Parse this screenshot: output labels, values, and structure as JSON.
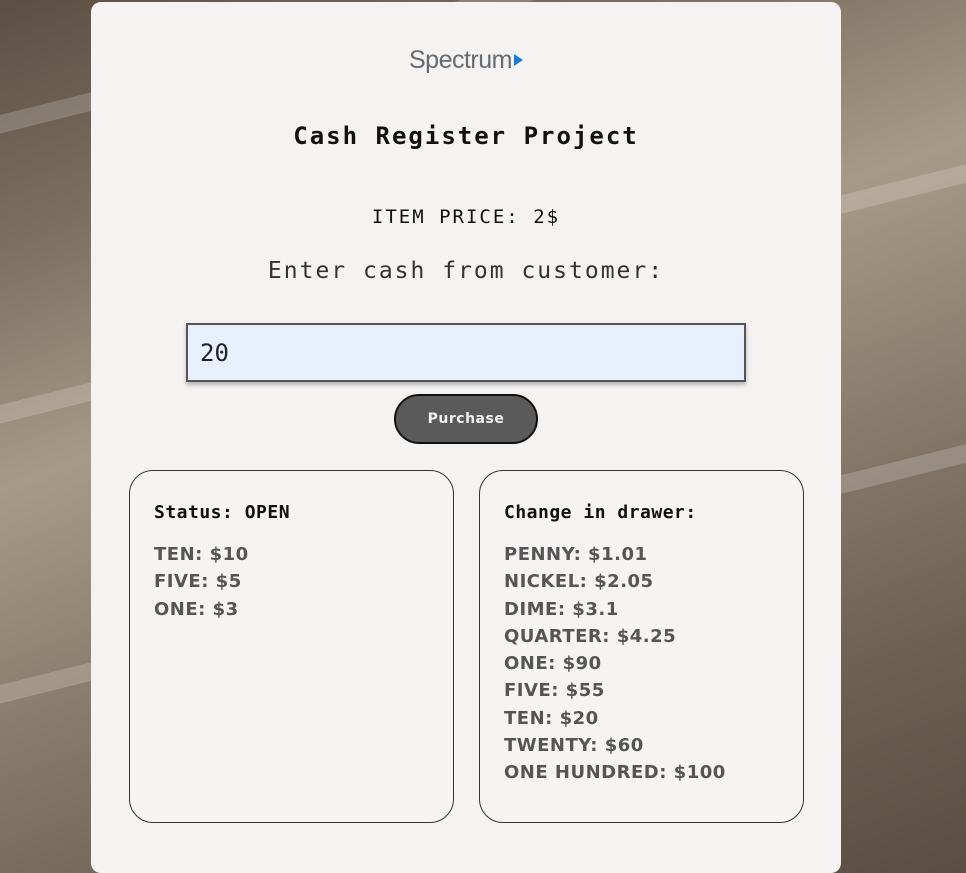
{
  "logo": {
    "text": "Spectrum"
  },
  "title": "Cash Register Project",
  "item_price": "ITEM PRICE: 2$",
  "prompt": "Enter cash from customer:",
  "cash_input": {
    "value": "20"
  },
  "purchase_button": {
    "label": "Purchase"
  },
  "status_panel": {
    "heading": "Status: OPEN",
    "items": [
      "TEN: $10",
      "FIVE: $5",
      "ONE: $3"
    ]
  },
  "drawer_panel": {
    "heading": "Change in drawer:",
    "items": [
      "PENNY: $1.01",
      "NICKEL: $2.05",
      "DIME: $3.1",
      "QUARTER: $4.25",
      "ONE: $90",
      "FIVE: $55",
      "TEN: $20",
      "TWENTY: $60",
      "ONE HUNDRED: $100"
    ]
  },
  "colors": {
    "card_background": "#f4f3f2",
    "input_background": "#e8f0fe",
    "button_background": "#5a5a5a",
    "logo_arrow": "#1f7ad2"
  }
}
